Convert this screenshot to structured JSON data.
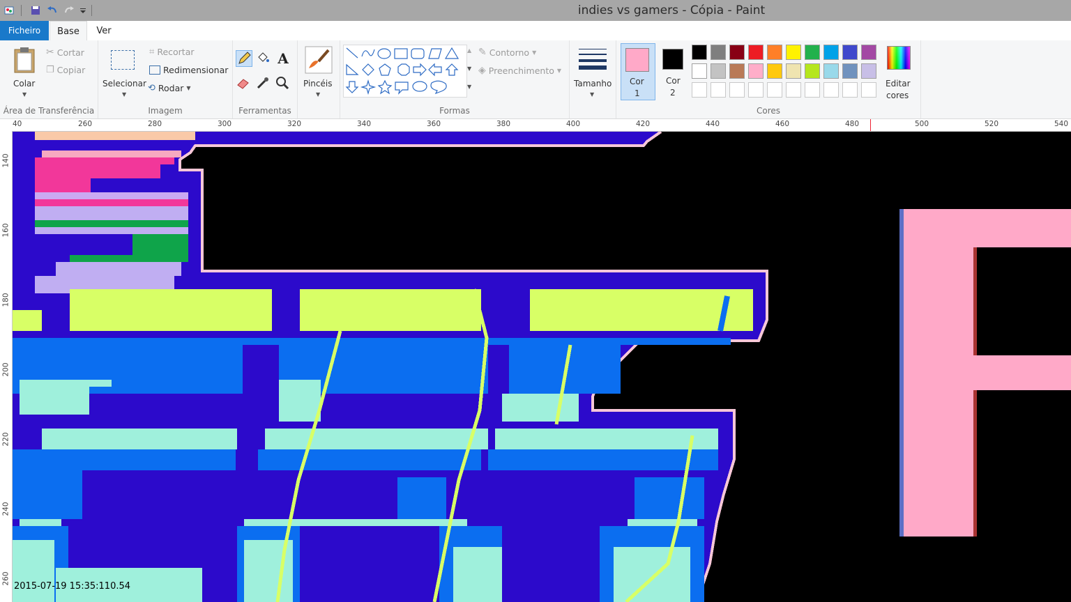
{
  "window": {
    "title": "indies vs gamers - Cópia - Paint"
  },
  "quick_access": {
    "icons": [
      "paint-app-icon",
      "save-icon",
      "undo-icon",
      "redo-icon",
      "customize-qat-icon"
    ]
  },
  "tabs": {
    "file": "Ficheiro",
    "home": "Base",
    "view": "Ver"
  },
  "clipboard": {
    "paste": "Colar",
    "cut": "Cortar",
    "copy": "Copiar",
    "label": "Área de Transferência"
  },
  "image": {
    "select": "Selecionar",
    "crop": "Recortar",
    "resize": "Redimensionar",
    "rotate": "Rodar",
    "label": "Imagem"
  },
  "tools": {
    "label": "Ferramentas"
  },
  "brushes": {
    "label": "Pincéis"
  },
  "shapes": {
    "outline": "Contorno",
    "fill": "Preenchimento",
    "label": "Formas"
  },
  "size": {
    "label": "Tamanho"
  },
  "colors": {
    "color1_label": "Cor",
    "color1_num": "1",
    "color2_label": "Cor",
    "color2_num": "2",
    "color1": "#ffa9c8",
    "color2": "#000000",
    "edit_line1": "Editar",
    "edit_line2": "cores",
    "label": "Cores",
    "palette_row1": [
      "#000000",
      "#7f7f7f",
      "#880015",
      "#ed1c24",
      "#ff7f27",
      "#fff200",
      "#22b14c",
      "#00a2e8",
      "#3f48cc",
      "#a349a4"
    ],
    "palette_row2": [
      "#ffffff",
      "#c3c3c3",
      "#b97a57",
      "#ffaec9",
      "#ffc90e",
      "#efe4b0",
      "#b5e61d",
      "#99d9ea",
      "#7092be",
      "#c8bfe7"
    ]
  },
  "ruler": {
    "top": [
      "40",
      "260",
      "280",
      "300",
      "320",
      "340",
      "360",
      "380",
      "400",
      "420",
      "440",
      "460",
      "480",
      "500",
      "520",
      "540"
    ],
    "left": [
      "140",
      "160",
      "180",
      "200",
      "220",
      "240",
      "260"
    ]
  },
  "timestamp": "2015-07-19 15:35:110.54"
}
